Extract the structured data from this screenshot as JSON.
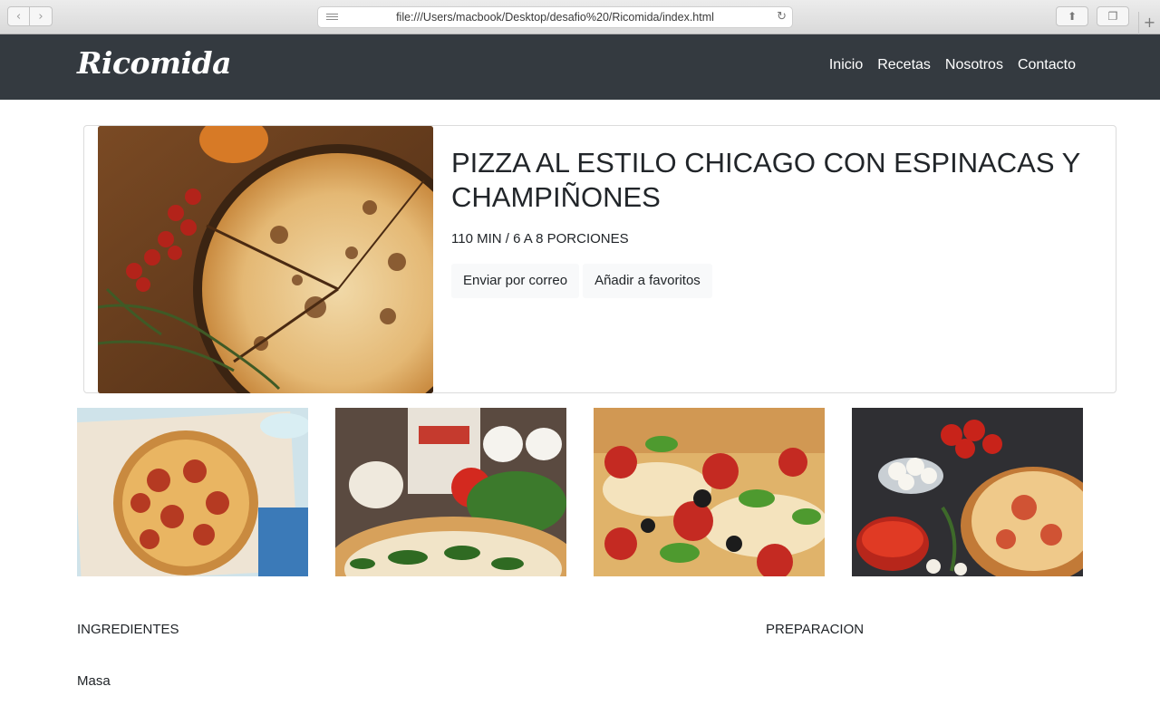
{
  "browser": {
    "url": "file:///Users/macbook/Desktop/desafio%20/Ricomida/index.html",
    "back_icon": "chevron-left-icon",
    "forward_icon": "chevron-right-icon",
    "reload_icon": "reload-icon",
    "share_icon": "share-icon",
    "tabs_icon": "tabs-icon",
    "new_tab_icon": "plus-icon"
  },
  "navbar": {
    "brand": "Ricomida",
    "links": [
      "Inicio",
      "Recetas",
      "Nosotros",
      "Contacto"
    ],
    "background": "#343a40"
  },
  "featured": {
    "title": "PIZZA AL ESTILO CHICAGO CON ESPINACAS Y CHAMPIÑONES",
    "meta": "110 MIN / 6 A 8 PORCIONES",
    "actions": [
      "Enviar por correo",
      "Añadir a favoritos"
    ]
  },
  "gallery": {
    "images": [
      "pepperoni-pizza-photo",
      "pizza-crust-ingredients-photo",
      "pizza-closeup-photo",
      "pizza-tomatoes-photo"
    ]
  },
  "sections": {
    "ingredients": "INGREDIENTES",
    "preparation": "PREPARACION",
    "dough": "Masa"
  }
}
